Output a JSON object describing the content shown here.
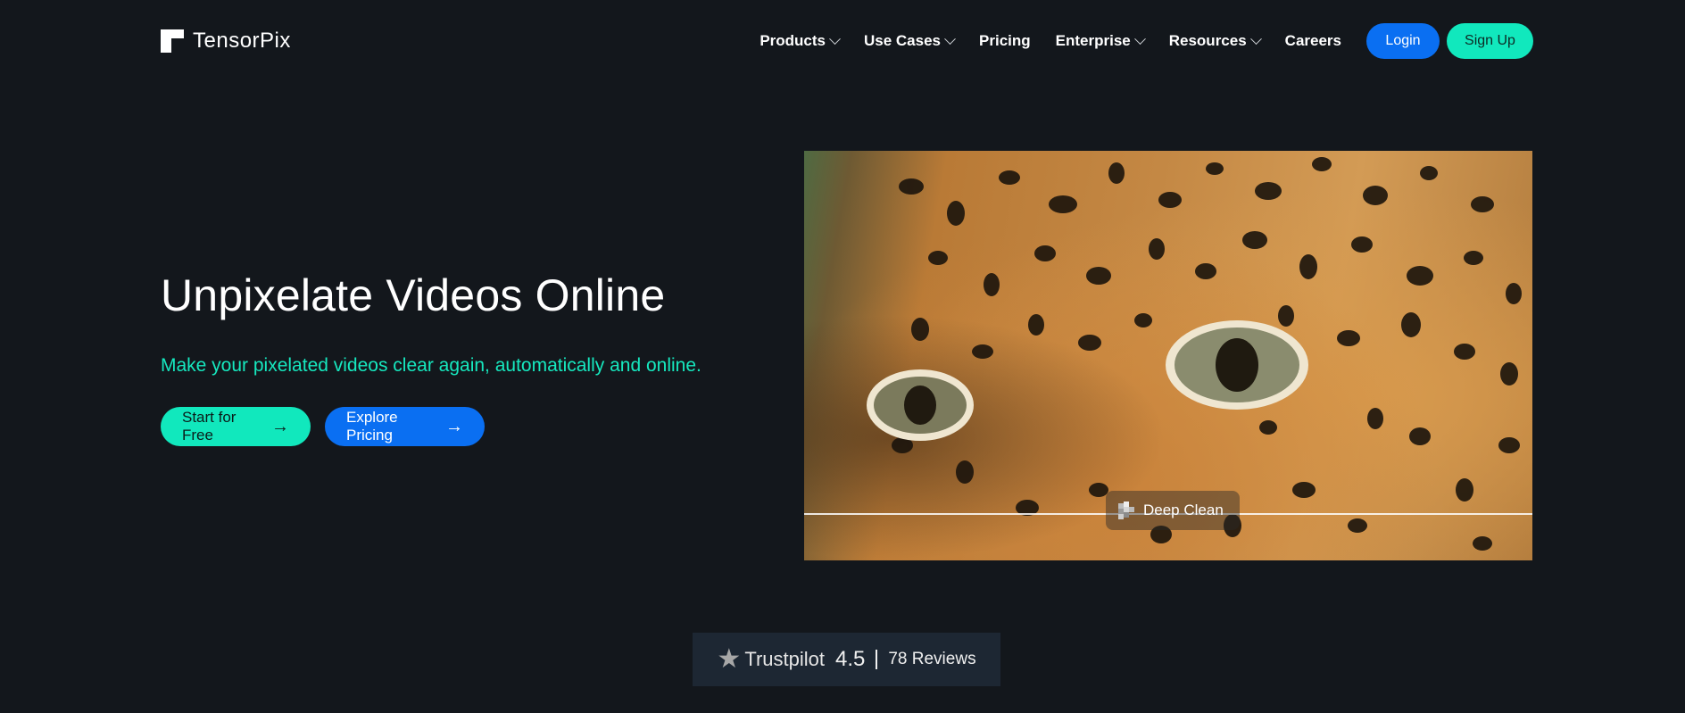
{
  "brand": {
    "name": "TensorPix",
    "icon": "tensorpix-logo"
  },
  "nav": {
    "items": [
      {
        "label": "Products",
        "dropdown": true
      },
      {
        "label": "Use Cases",
        "dropdown": true
      },
      {
        "label": "Pricing",
        "dropdown": false
      },
      {
        "label": "Enterprise",
        "dropdown": true
      },
      {
        "label": "Resources",
        "dropdown": true
      },
      {
        "label": "Careers",
        "dropdown": false
      }
    ],
    "login_label": "Login",
    "signup_label": "Sign Up"
  },
  "hero": {
    "title": "Unpixelate Videos Online",
    "subtitle": "Make your pixelated videos clear again, automatically and online.",
    "cta_primary": "Start for Free",
    "cta_secondary": "Explore Pricing",
    "compare_badge": "Deep Clean"
  },
  "trustpilot": {
    "brand": "Trustpilot",
    "rating": "4.5",
    "reviews": "78 Reviews"
  },
  "colors": {
    "background": "#13171c",
    "accent_teal": "#11e8bd",
    "accent_blue": "#0a6ff2",
    "trust_bg": "#1d2733"
  }
}
